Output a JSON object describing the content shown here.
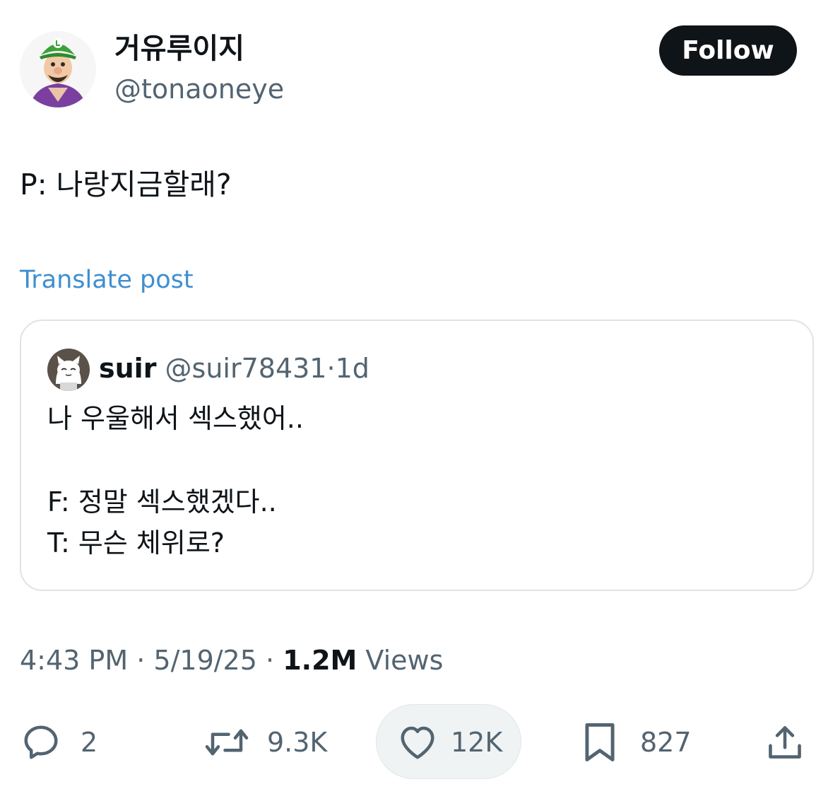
{
  "author": {
    "display_name": "거유루이지",
    "handle": "@tonaoneye",
    "avatar_icon": "luigi-avatar"
  },
  "follow_label": "Follow",
  "post": {
    "text": "P: 나랑지금할래?",
    "translate_label": "Translate post"
  },
  "quoted": {
    "name": "suir",
    "handle": "@suir78431",
    "separator": "·",
    "time": "1d",
    "lines": [
      "나 우울해서 섹스했어..",
      "F: 정말 섹스했겠다..",
      "T: 무슨 체위로?"
    ]
  },
  "meta": {
    "time": "4:43 PM",
    "sep1": "·",
    "date": "5/19/25",
    "sep2": "·",
    "views_count": "1.2M",
    "views_label": "Views"
  },
  "actions": {
    "replies": "2",
    "reposts": "9.3K",
    "likes": "12K",
    "bookmarks": "827"
  },
  "colors": {
    "text": "#0f1419",
    "secondary": "#536471",
    "link": "#3e8fd0",
    "follow_bg": "#0f1419",
    "border": "#dfe3e7"
  }
}
